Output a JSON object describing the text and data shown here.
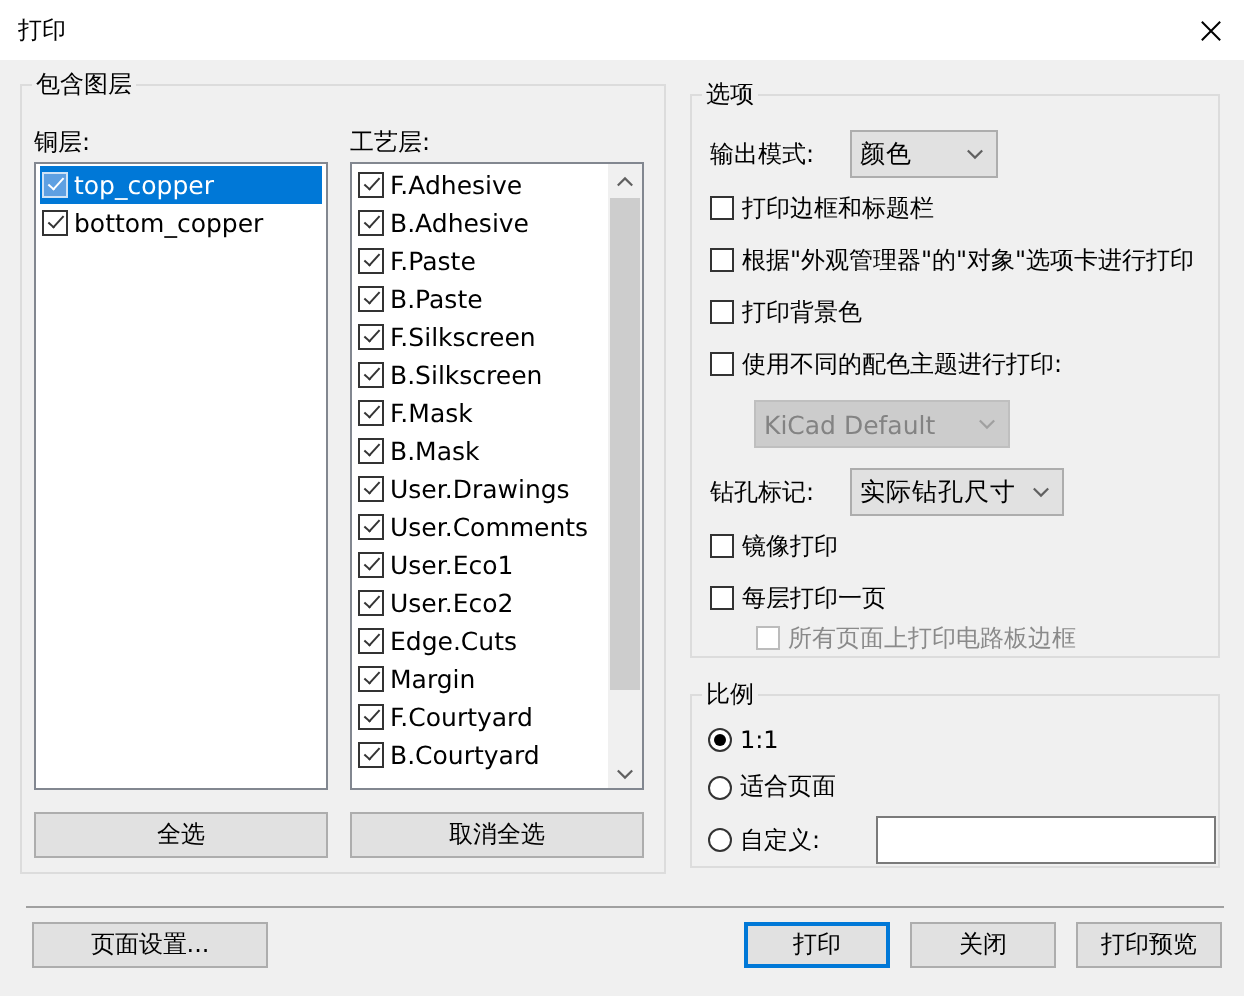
{
  "window": {
    "title": "打印"
  },
  "layers": {
    "title": "包含图层",
    "copper": {
      "label": "铜层:",
      "items": [
        {
          "label": "top_copper",
          "checked": true,
          "selected": true
        },
        {
          "label": "bottom_copper",
          "checked": true,
          "selected": false
        }
      ]
    },
    "technical": {
      "label": "工艺层:",
      "items": [
        {
          "label": "F.Adhesive",
          "checked": true,
          "selected": false
        },
        {
          "label": "B.Adhesive",
          "checked": true,
          "selected": false
        },
        {
          "label": "F.Paste",
          "checked": true,
          "selected": false
        },
        {
          "label": "B.Paste",
          "checked": true,
          "selected": false
        },
        {
          "label": "F.Silkscreen",
          "checked": true,
          "selected": false
        },
        {
          "label": "B.Silkscreen",
          "checked": true,
          "selected": false
        },
        {
          "label": "F.Mask",
          "checked": true,
          "selected": false
        },
        {
          "label": "B.Mask",
          "checked": true,
          "selected": false
        },
        {
          "label": "User.Drawings",
          "checked": true,
          "selected": false
        },
        {
          "label": "User.Comments",
          "checked": true,
          "selected": false
        },
        {
          "label": "User.Eco1",
          "checked": true,
          "selected": false
        },
        {
          "label": "User.Eco2",
          "checked": true,
          "selected": false
        },
        {
          "label": "Edge.Cuts",
          "checked": true,
          "selected": false
        },
        {
          "label": "Margin",
          "checked": true,
          "selected": false
        },
        {
          "label": "F.Courtyard",
          "checked": true,
          "selected": false
        },
        {
          "label": "B.Courtyard",
          "checked": true,
          "selected": false
        }
      ]
    },
    "buttons": [
      "全选",
      "取消全选"
    ]
  },
  "options": {
    "title": "选项",
    "items": [
      {
        "kind": "select",
        "label": "输出模式:",
        "value": "颜色",
        "disabled": false
      },
      {
        "kind": "checkbox",
        "label": "打印边框和标题栏",
        "checked": false,
        "disabled": false
      },
      {
        "kind": "checkbox",
        "label": "根据\"外观管理器\"的\"对象\"选项卡进行打印",
        "checked": false,
        "disabled": false
      },
      {
        "kind": "checkbox",
        "label": "打印背景色",
        "checked": false,
        "disabled": false
      },
      {
        "kind": "checkbox",
        "label": "使用不同的配色主题进行打印:",
        "checked": false,
        "disabled": false,
        "children": [
          {
            "kind": "select",
            "value": "KiCad Default",
            "disabled": true
          }
        ]
      },
      {
        "kind": "select",
        "label": "钻孔标记:",
        "value": "实际钻孔尺寸",
        "disabled": false
      },
      {
        "kind": "checkbox",
        "label": "镜像打印",
        "checked": false,
        "disabled": false
      },
      {
        "kind": "checkbox",
        "label": "每层打印一页",
        "checked": false,
        "disabled": false,
        "children": [
          {
            "kind": "checkbox",
            "label": "所有页面上打印电路板边框",
            "checked": false,
            "disabled": true
          }
        ]
      }
    ]
  },
  "scale": {
    "title": "比例",
    "options": [
      {
        "kind": "radio",
        "label": "1:1",
        "selected": true
      },
      {
        "kind": "radio",
        "label": "适合页面",
        "selected": false
      },
      {
        "kind": "radio_input",
        "label": "自定义:",
        "selected": false
      }
    ]
  },
  "footer": {
    "left_buttons": [
      {
        "label": "页面设置...",
        "default": false
      }
    ],
    "right_buttons": [
      {
        "label": "打印",
        "default": true
      },
      {
        "label": "关闭",
        "default": false
      },
      {
        "label": "打印预览",
        "default": false
      }
    ]
  }
}
